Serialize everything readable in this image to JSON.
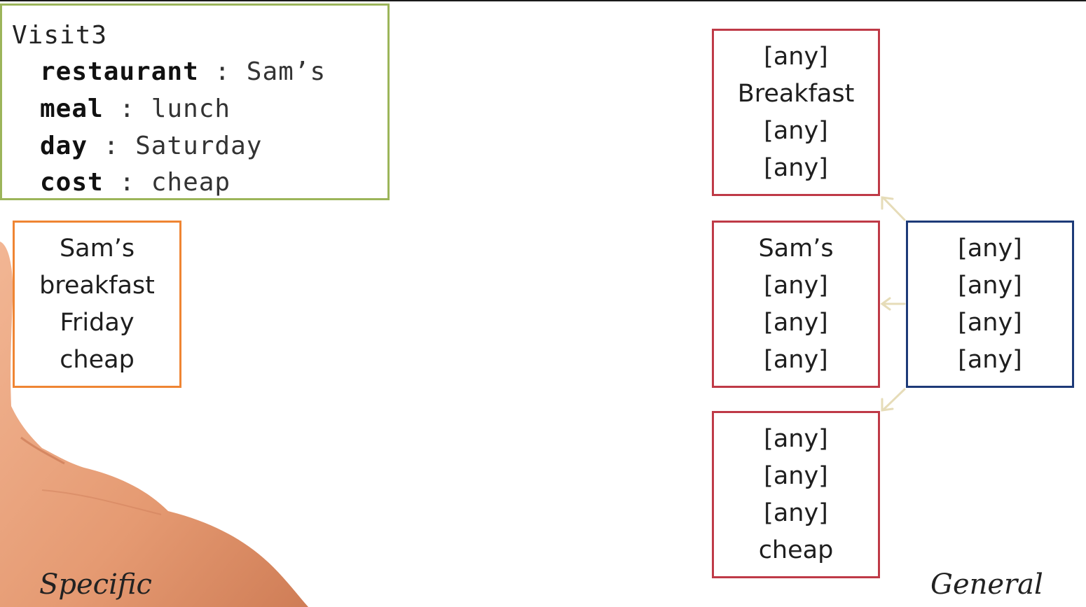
{
  "visit": {
    "title": "Visit3",
    "attributes": [
      {
        "key": "restaurant",
        "sep": " : ",
        "value": "Sam’s"
      },
      {
        "key": "meal",
        "sep": " : ",
        "value": "lunch"
      },
      {
        "key": "day",
        "sep": " : ",
        "value": "Saturday"
      },
      {
        "key": "cost",
        "sep": " : ",
        "value": "cheap"
      }
    ]
  },
  "specific_hypothesis": [
    "Sam’s",
    "breakfast",
    "Friday",
    "cheap"
  ],
  "general_hypothesis": [
    "[any]",
    "[any]",
    "[any]",
    "[any]"
  ],
  "refined_hypotheses": [
    [
      "[any]",
      "Breakfast",
      "[any]",
      "[any]"
    ],
    [
      "Sam’s",
      "[any]",
      "[any]",
      "[any]"
    ],
    [
      "[any]",
      "[any]",
      "[any]",
      "cheap"
    ]
  ],
  "labels": {
    "specific": "Specific",
    "general": "General"
  },
  "colors": {
    "visit_border": "#9cb55a",
    "specific_border": "#ef8533",
    "refined_border": "#bf3a47",
    "general_border": "#1d3a78",
    "arrow": "#e6dcb8",
    "hand": "#e8a079"
  }
}
